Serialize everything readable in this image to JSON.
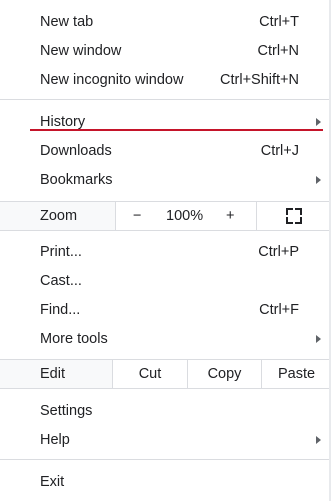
{
  "menu": {
    "new_tab": {
      "label": "New tab",
      "shortcut": "Ctrl+T"
    },
    "new_window": {
      "label": "New window",
      "shortcut": "Ctrl+N"
    },
    "new_incognito": {
      "label": "New incognito window",
      "shortcut": "Ctrl+Shift+N"
    },
    "history": {
      "label": "History"
    },
    "downloads": {
      "label": "Downloads",
      "shortcut": "Ctrl+J"
    },
    "bookmarks": {
      "label": "Bookmarks"
    },
    "zoom": {
      "label": "Zoom",
      "minus": "−",
      "level": "100%",
      "plus": "+",
      "fullscreen_icon": "fullscreen-icon"
    },
    "print": {
      "label": "Print...",
      "shortcut": "Ctrl+P"
    },
    "cast": {
      "label": "Cast..."
    },
    "find": {
      "label": "Find...",
      "shortcut": "Ctrl+F"
    },
    "more_tools": {
      "label": "More tools"
    },
    "edit": {
      "label": "Edit",
      "cut": "Cut",
      "copy": "Copy",
      "paste": "Paste"
    },
    "settings": {
      "label": "Settings"
    },
    "help": {
      "label": "Help"
    },
    "exit": {
      "label": "Exit"
    }
  },
  "colors": {
    "accent_underline": "#c5142a",
    "separator": "#dadce0",
    "text": "#202124"
  }
}
